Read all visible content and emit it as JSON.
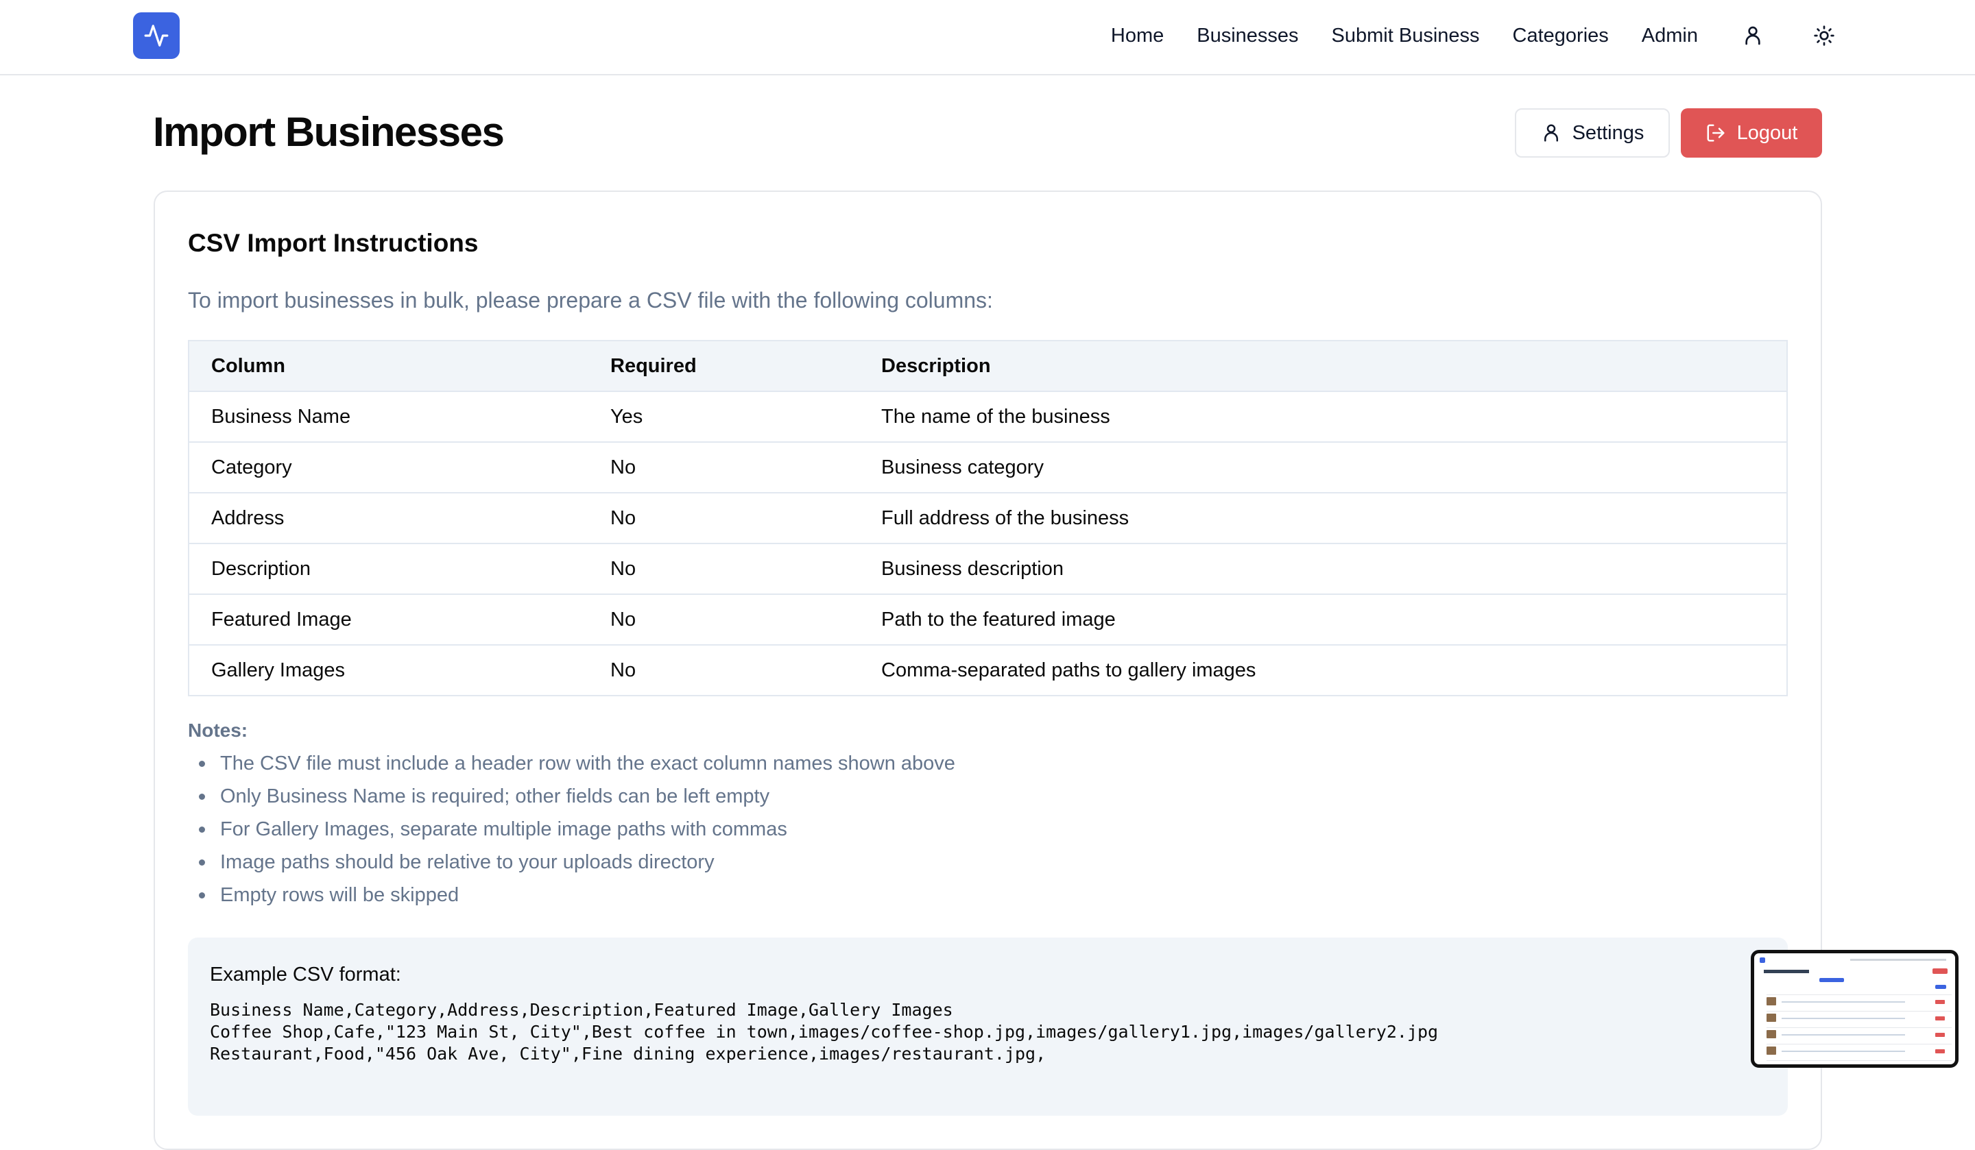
{
  "nav": {
    "links": [
      "Home",
      "Businesses",
      "Submit Business",
      "Categories",
      "Admin"
    ],
    "icons": [
      "activity-icon",
      "user-icon",
      "sun-icon"
    ]
  },
  "page": {
    "title": "Import Businesses",
    "settings_label": "Settings",
    "logout_label": "Logout"
  },
  "instructions": {
    "title": "CSV Import Instructions",
    "intro": "To import businesses in bulk, please prepare a CSV file with the following columns:",
    "table": {
      "headers": [
        "Column",
        "Required",
        "Description"
      ],
      "rows": [
        [
          "Business Name",
          "Yes",
          "The name of the business"
        ],
        [
          "Category",
          "No",
          "Business category"
        ],
        [
          "Address",
          "No",
          "Full address of the business"
        ],
        [
          "Description",
          "No",
          "Business description"
        ],
        [
          "Featured Image",
          "No",
          "Path to the featured image"
        ],
        [
          "Gallery Images",
          "No",
          "Comma-separated paths to gallery images"
        ]
      ]
    },
    "notes_title": "Notes:",
    "notes": [
      "The CSV file must include a header row with the exact column names shown above",
      "Only Business Name is required; other fields can be left empty",
      "For Gallery Images, separate multiple image paths with commas",
      "Image paths should be relative to your uploads directory",
      "Empty rows will be skipped"
    ],
    "example_title": "Example CSV format:",
    "example_lines": [
      "Business Name,Category,Address,Description,Featured Image,Gallery Images",
      "Coffee Shop,Cafe,\"123 Main St, City\",Best coffee in town,images/coffee-shop.jpg,images/gallery1.jpg,images/gallery2.jpg",
      "Restaurant,Food,\"456 Oak Ave, City\",Fine dining experience,images/restaurant.jpg,"
    ]
  },
  "colors": {
    "brand": "#3b63e0",
    "logout": "#e05555",
    "muted_text": "#64748b",
    "table_header_bg": "#f1f5f9"
  }
}
